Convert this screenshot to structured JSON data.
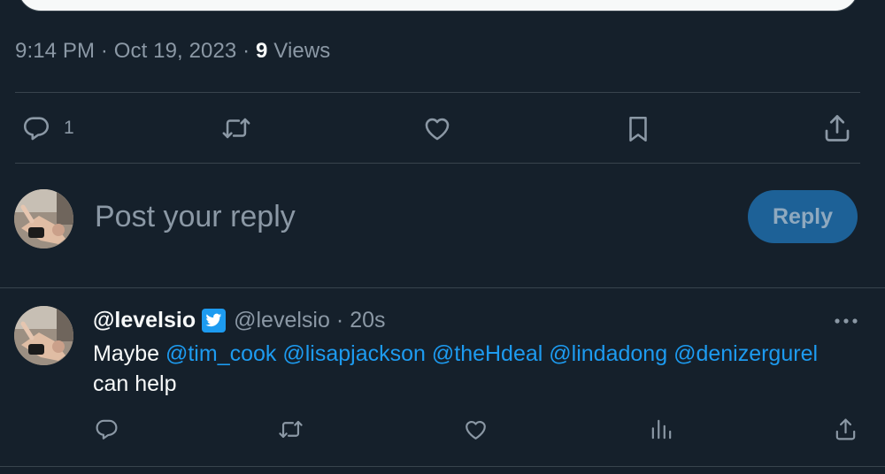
{
  "tweet_meta": {
    "time": "9:14 PM",
    "dot1": "·",
    "date": "Oct 19, 2023",
    "dot2": "·",
    "views_count": "9",
    "views_label": "Views"
  },
  "main_actions": {
    "reply": {
      "icon": "reply-icon",
      "count": "1"
    },
    "retweet": {
      "icon": "retweet-icon"
    },
    "like": {
      "icon": "heart-icon"
    },
    "bookmark": {
      "icon": "bookmark-icon"
    },
    "share": {
      "icon": "share-icon"
    }
  },
  "composer": {
    "placeholder": "Post your reply",
    "value": "",
    "button_label": "Reply"
  },
  "reply": {
    "display_name": "@levelsio",
    "badge_icon": "twitter-bird-icon",
    "handle": "@levelsio",
    "separator": "·",
    "time": "20s",
    "text_prefix": "Maybe ",
    "mentions": [
      "@tim_cook",
      "@lisapjackson",
      "@theHdeal",
      "@lindadong",
      "@denizergurel"
    ],
    "text_suffix": "can help",
    "actions": [
      "reply-icon",
      "retweet-icon",
      "heart-icon",
      "analytics-icon",
      "share-icon"
    ]
  },
  "colors": {
    "background": "#15202b",
    "divider": "#38444d",
    "muted_text": "#8b98a5",
    "primary_text": "#f7f9f9",
    "accent": "#1d9bf0",
    "reply_button_disabled": "#1d6197"
  }
}
